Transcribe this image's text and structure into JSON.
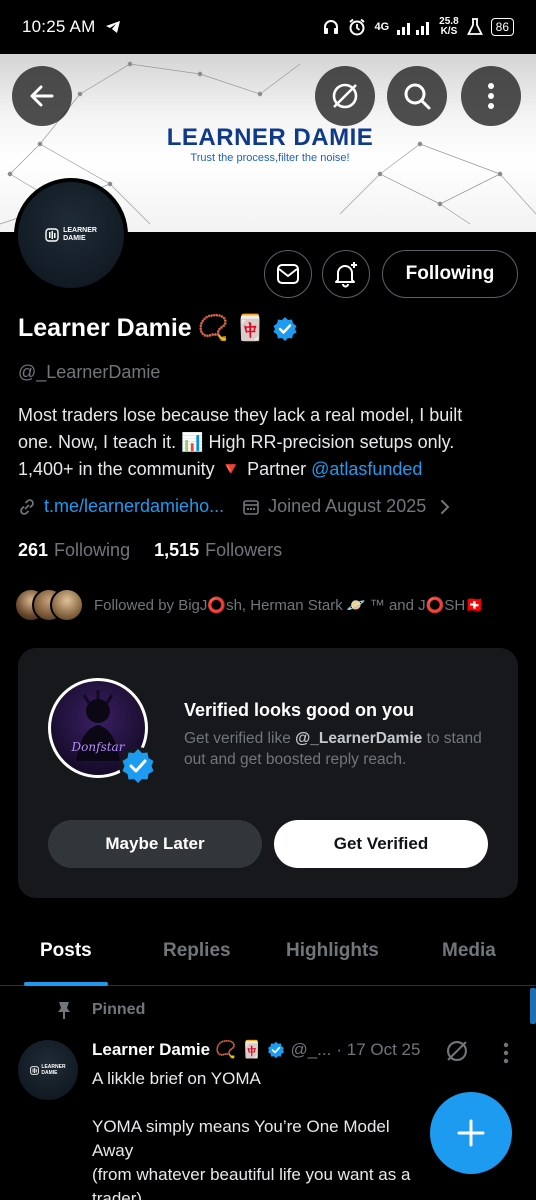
{
  "status_bar": {
    "time": "10:25 AM",
    "net_type": "4G",
    "speed_value": "25.8",
    "speed_unit": "K/S",
    "battery": "86"
  },
  "banner": {
    "brand_title": "LEARNER DAMIE",
    "brand_tagline": "Trust the process,filter the noise!",
    "icons": [
      "back-arrow-icon",
      "grok-icon",
      "search-icon",
      "more-vertical-icon"
    ]
  },
  "avatar": {
    "logo_line1": "LEARNER",
    "logo_line2": "DAMIE"
  },
  "actions": {
    "follow_label": "Following",
    "icons": [
      "message-icon",
      "notification-bell-icon"
    ]
  },
  "profile": {
    "name": "Learner Damie",
    "name_emoji_1": "📿",
    "name_emoji_2": "🀄",
    "handle": "@_LearnerDamie",
    "bio_line1": "Most traders lose because they lack a real model, I built",
    "bio_line2_a": "one. Now, I teach it. ",
    "bio_emoji_chart": "📊",
    "bio_line2_b": " High RR-precision setups only.",
    "bio_line3_a": "1,400+ in the community ",
    "bio_emoji_triangle": "🔻",
    "bio_line3_b": "Partner ",
    "bio_mention": "@atlasfunded",
    "website": "t.me/learnerdamieho...",
    "joined": "Joined August 2025",
    "following_count": "261",
    "following_label": "Following",
    "followers_count": "1,515",
    "followers_label": "Followers",
    "followed_by": "Followed by BigJ⭕sh, Herman Stark 🪐 ™ and J⭕SH🇨🇭"
  },
  "verified_card": {
    "title": "Verified looks good on you",
    "desc_a": "Get verified like ",
    "desc_handle": "@_LearnerDamie",
    "desc_b": " to stand out and get boosted reply reach.",
    "avatar_text": "Donfstar",
    "later_label": "Maybe Later",
    "verify_label": "Get Verified"
  },
  "tabs": [
    {
      "label": "Posts",
      "active": true
    },
    {
      "label": "Replies",
      "active": false
    },
    {
      "label": "Highlights",
      "active": false
    },
    {
      "label": "Media",
      "active": false
    }
  ],
  "post": {
    "pinned_label": "Pinned",
    "author": "Learner Damie",
    "emoji_1": "📿",
    "emoji_2": "🀄",
    "handle": "@_...",
    "date": "· 17 Oct 25",
    "body": "A likkle brief on YOMA\n\nYOMA simply means You’re One Model Away\n(from whatever beautiful life you want as a\ntrader)"
  },
  "colors": {
    "accent": "#1d9bf0",
    "background": "#000000",
    "muted": "#71767b",
    "card": "#16181c"
  }
}
